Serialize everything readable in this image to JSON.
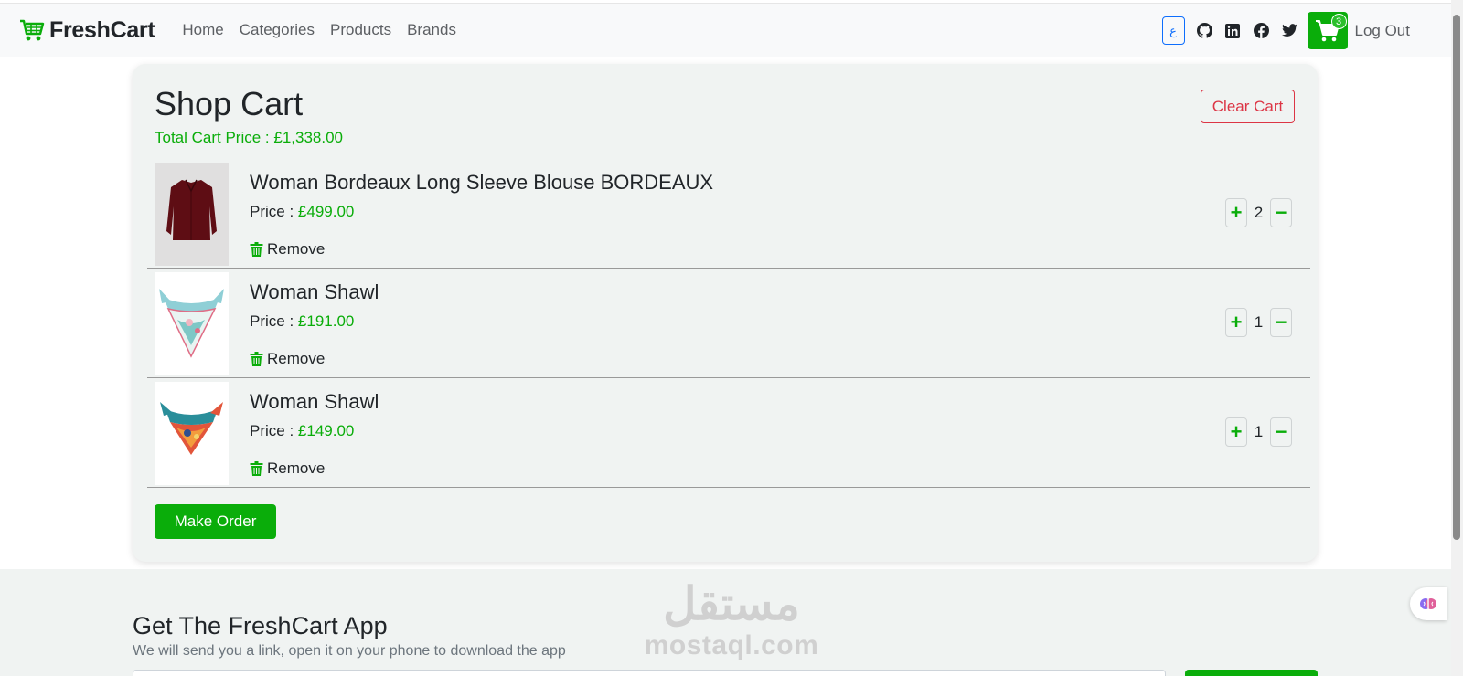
{
  "brand": {
    "name": "FreshCart"
  },
  "nav": {
    "links": [
      "Home",
      "Categories",
      "Products",
      "Brands"
    ],
    "lang_label": "ع",
    "cart_count": "3",
    "logout": "Log Out"
  },
  "cart": {
    "title": "Shop Cart",
    "total_label": "Total Cart Price : ",
    "total_value": "£1,338.00",
    "clear_label": "Clear Cart",
    "price_label": "Price : ",
    "remove_label": "Remove",
    "items": [
      {
        "name": "Woman Bordeaux Long Sleeve Blouse BORDEAUX",
        "price": "£499.00",
        "qty": "2",
        "image": "burgundy-blouse"
      },
      {
        "name": "Woman Shawl",
        "price": "£191.00",
        "qty": "1",
        "image": "pastel-scarf"
      },
      {
        "name": "Woman Shawl",
        "price": "£149.00",
        "qty": "1",
        "image": "colorful-scarf"
      }
    ],
    "order_label": "Make Order"
  },
  "footer": {
    "title": "Get The FreshCart App",
    "subtitle": "We will send you a link, open it on your phone to download the app"
  },
  "watermark": {
    "arabic": "مستقل",
    "latin": "mostaql.com"
  },
  "colors": {
    "accent": "#0aad0a",
    "danger": "#dc3545",
    "panel": "#f0f3f2"
  }
}
